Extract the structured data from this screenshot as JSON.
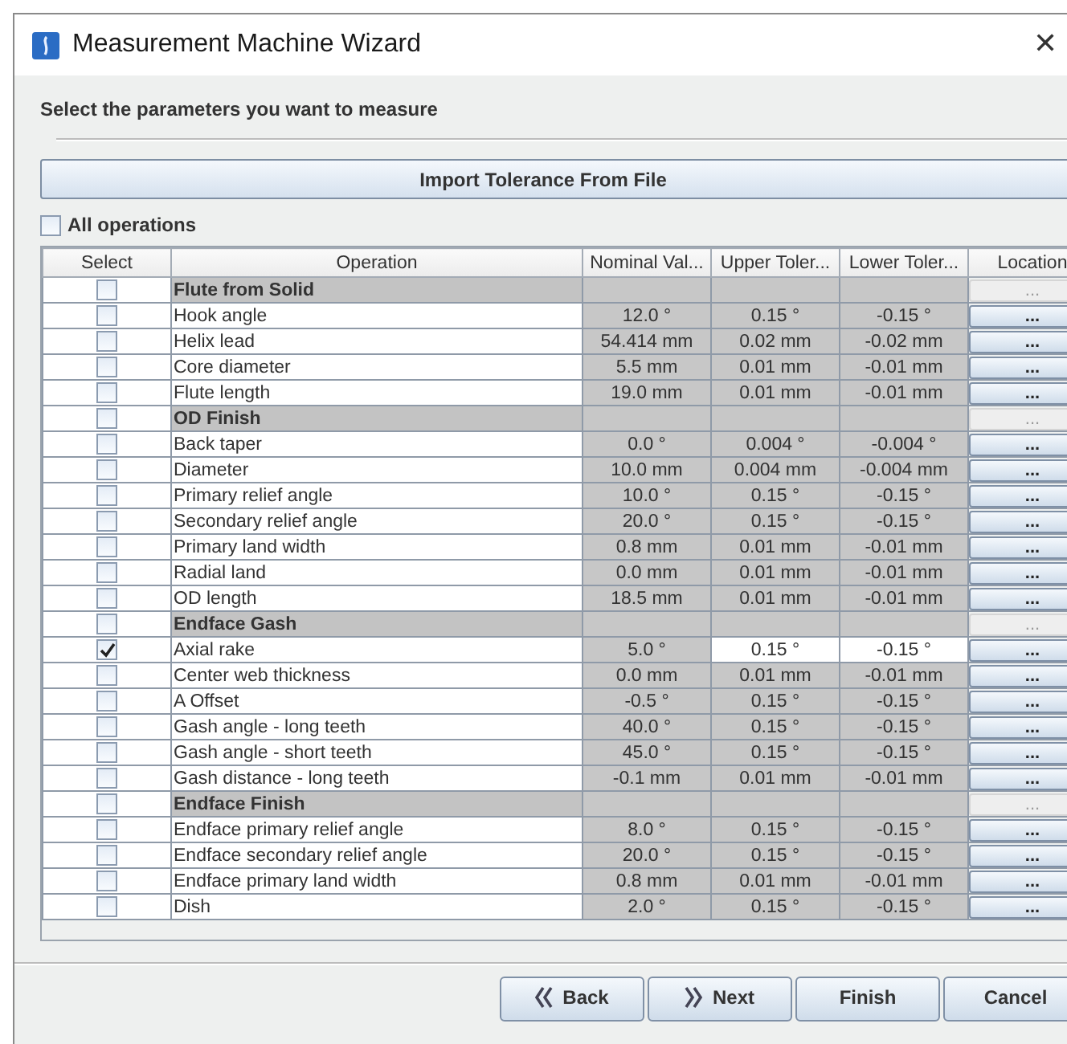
{
  "window": {
    "title": "Measurement Machine Wizard",
    "close": "✕"
  },
  "instruction": "Select the parameters you want to measure",
  "import_button": "Import Tolerance From File",
  "all_operations": {
    "label": "All operations",
    "checked": false
  },
  "table": {
    "columns": [
      "Select",
      "Operation",
      "Nominal Val...",
      "Upper Toler...",
      "Lower Toler...",
      "Location"
    ],
    "rows": [
      {
        "kind": "group",
        "operation": "Flute from Solid",
        "checked": false,
        "location": "..."
      },
      {
        "kind": "param",
        "operation": "Hook angle",
        "nominal": "12.0 °",
        "upper": "0.15 °",
        "lower": "-0.15 °",
        "checked": false,
        "editable": false,
        "location": "..."
      },
      {
        "kind": "param",
        "operation": "Helix lead",
        "nominal": "54.414 mm",
        "upper": "0.02 mm",
        "lower": "-0.02 mm",
        "checked": false,
        "editable": false,
        "location": "..."
      },
      {
        "kind": "param",
        "operation": "Core diameter",
        "nominal": "5.5 mm",
        "upper": "0.01 mm",
        "lower": "-0.01 mm",
        "checked": false,
        "editable": false,
        "location": "..."
      },
      {
        "kind": "param",
        "operation": "Flute length",
        "nominal": "19.0 mm",
        "upper": "0.01 mm",
        "lower": "-0.01 mm",
        "checked": false,
        "editable": false,
        "location": "..."
      },
      {
        "kind": "group",
        "operation": "OD Finish",
        "checked": false,
        "location": "..."
      },
      {
        "kind": "param",
        "operation": "Back taper",
        "nominal": "0.0 °",
        "upper": "0.004 °",
        "lower": "-0.004 °",
        "checked": false,
        "editable": false,
        "location": "..."
      },
      {
        "kind": "param",
        "operation": "Diameter",
        "nominal": "10.0 mm",
        "upper": "0.004 mm",
        "lower": "-0.004 mm",
        "checked": false,
        "editable": false,
        "location": "..."
      },
      {
        "kind": "param",
        "operation": "Primary relief angle",
        "nominal": "10.0 °",
        "upper": "0.15 °",
        "lower": "-0.15 °",
        "checked": false,
        "editable": false,
        "location": "..."
      },
      {
        "kind": "param",
        "operation": "Secondary relief angle",
        "nominal": "20.0 °",
        "upper": "0.15 °",
        "lower": "-0.15 °",
        "checked": false,
        "editable": false,
        "location": "..."
      },
      {
        "kind": "param",
        "operation": "Primary land width",
        "nominal": "0.8 mm",
        "upper": "0.01 mm",
        "lower": "-0.01 mm",
        "checked": false,
        "editable": false,
        "location": "..."
      },
      {
        "kind": "param",
        "operation": "Radial land",
        "nominal": "0.0 mm",
        "upper": "0.01 mm",
        "lower": "-0.01 mm",
        "checked": false,
        "editable": false,
        "location": "..."
      },
      {
        "kind": "param",
        "operation": "OD length",
        "nominal": "18.5 mm",
        "upper": "0.01 mm",
        "lower": "-0.01 mm",
        "checked": false,
        "editable": false,
        "location": "..."
      },
      {
        "kind": "group",
        "operation": "Endface Gash",
        "checked": false,
        "location": "..."
      },
      {
        "kind": "param",
        "operation": "Axial rake",
        "nominal": "5.0 °",
        "upper": "0.15 °",
        "lower": "-0.15 °",
        "checked": true,
        "editable": true,
        "location": "..."
      },
      {
        "kind": "param",
        "operation": "Center web thickness",
        "nominal": "0.0 mm",
        "upper": "0.01 mm",
        "lower": "-0.01 mm",
        "checked": false,
        "editable": false,
        "location": "..."
      },
      {
        "kind": "param",
        "operation": "A Offset",
        "nominal": "-0.5 °",
        "upper": "0.15 °",
        "lower": "-0.15 °",
        "checked": false,
        "editable": false,
        "location": "..."
      },
      {
        "kind": "param",
        "operation": "Gash angle - long teeth",
        "nominal": "40.0 °",
        "upper": "0.15 °",
        "lower": "-0.15 °",
        "checked": false,
        "editable": false,
        "location": "..."
      },
      {
        "kind": "param",
        "operation": "Gash angle - short teeth",
        "nominal": "45.0 °",
        "upper": "0.15 °",
        "lower": "-0.15 °",
        "checked": false,
        "editable": false,
        "location": "..."
      },
      {
        "kind": "param",
        "operation": "Gash distance - long teeth",
        "nominal": "-0.1 mm",
        "upper": "0.01 mm",
        "lower": "-0.01 mm",
        "checked": false,
        "editable": false,
        "location": "..."
      },
      {
        "kind": "group",
        "operation": "Endface Finish",
        "checked": false,
        "location": "..."
      },
      {
        "kind": "param",
        "operation": "Endface primary relief angle",
        "nominal": "8.0 °",
        "upper": "0.15 °",
        "lower": "-0.15 °",
        "checked": false,
        "editable": false,
        "location": "..."
      },
      {
        "kind": "param",
        "operation": "Endface secondary relief angle",
        "nominal": "20.0 °",
        "upper": "0.15 °",
        "lower": "-0.15 °",
        "checked": false,
        "editable": false,
        "location": "..."
      },
      {
        "kind": "param",
        "operation": "Endface primary land width",
        "nominal": "0.8 mm",
        "upper": "0.01 mm",
        "lower": "-0.01 mm",
        "checked": false,
        "editable": false,
        "location": "..."
      },
      {
        "kind": "param",
        "operation": "Dish",
        "nominal": "2.0 °",
        "upper": "0.15 °",
        "lower": "-0.15 °",
        "checked": false,
        "editable": false,
        "location": "..."
      }
    ]
  },
  "buttons": [
    {
      "kind": "back",
      "label": "Back"
    },
    {
      "kind": "next",
      "label": "Next"
    },
    {
      "kind": "plain",
      "label": "Finish"
    },
    {
      "kind": "plain",
      "label": "Cancel"
    }
  ]
}
